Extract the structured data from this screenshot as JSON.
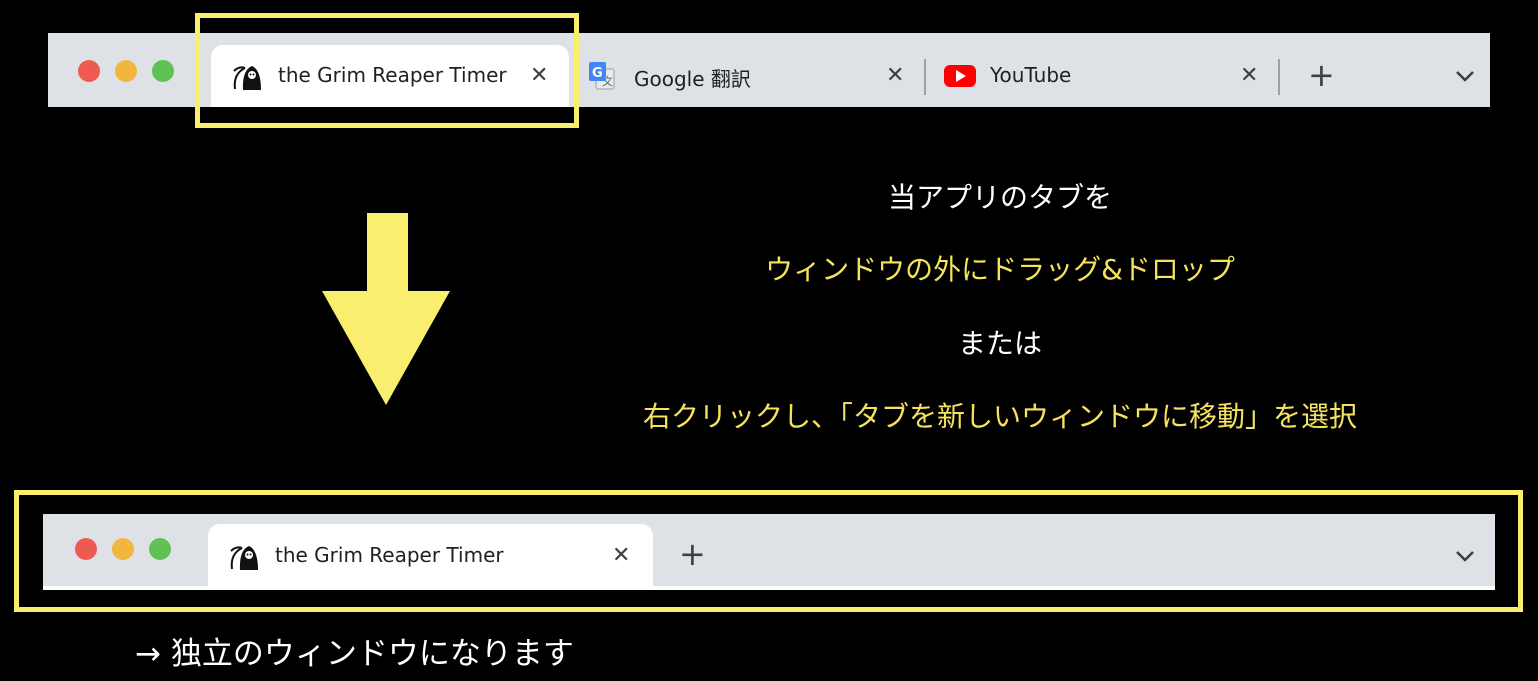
{
  "top_window": {
    "tabs": [
      {
        "title": "the Grim Reaper Timer",
        "icon": "grim-reaper-icon",
        "active": true
      },
      {
        "title": "Google 翻訳",
        "icon": "google-translate-icon",
        "active": false
      },
      {
        "title": "YouTube",
        "icon": "youtube-icon",
        "active": false
      }
    ],
    "new_tab": "+",
    "close_glyph": "✕"
  },
  "bottom_window": {
    "tabs": [
      {
        "title": "the Grim Reaper Timer",
        "icon": "grim-reaper-icon",
        "active": true
      }
    ],
    "new_tab": "+",
    "close_glyph": "✕"
  },
  "instructions": {
    "line1": "当アプリのタブを",
    "line2": "ウィンドウの外にドラッグ&ドロップ",
    "line3": "または",
    "line4": "右クリックし、「タブを新しいウィンドウに移動」を選択"
  },
  "result_text": "→ 独立のウィンドウになります",
  "colors": {
    "highlight": "#f8ef6a",
    "instruction_accent": "#f6e35c",
    "tabstrip_bg": "#dee1e6",
    "youtube_red": "#ff0000"
  }
}
